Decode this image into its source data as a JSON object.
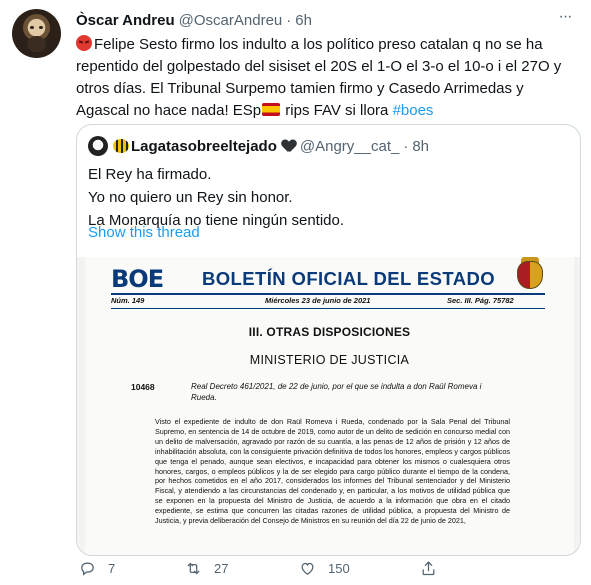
{
  "tweet": {
    "author_name": "Òscar Andreu",
    "author_handle": "@OscarAndreu",
    "separator": "·",
    "time": "6h",
    "more_label": "···",
    "text_part1": "Felipe Sesto firmo los indulto a los político preso catalan q no se ha repentido del golpestado del sisiset el 20S  el 1-O el 3-o  el 10-o i el 27O y otros días. El Tribunal Surpemo tamien firmo y Casedo Arrimedas y Agascal no hace nada! ESp",
    "text_part2": " rips FAV si llora ",
    "hashtag": "#boes",
    "emoji_start": "angry-face",
    "emoji_flag": "spain-flag"
  },
  "quote": {
    "name": "Lagatasobreeltejado",
    "handle": "@Angry__cat_",
    "separator": "·",
    "time": "8h",
    "lines": [
      "El Rey ha firmado.",
      "Yo no quiero un Rey sin honor.",
      "La Monarquía no tiene ningún sentido."
    ],
    "show_thread": "Show this thread"
  },
  "document": {
    "logo": "BOE",
    "title": "BOLETÍN OFICIAL DEL ESTADO",
    "number": "Núm. 149",
    "date": "Miércoles 23 de junio de 2021",
    "section_page": "Sec. III.  Pág. 75782",
    "section_title": "III. OTRAS DISPOSICIONES",
    "ministry": "MINISTERIO DE JUSTICIA",
    "doc_number": "10468",
    "decree": "Real Decreto 461/2021, de 22 de junio, por el que se indulta a don Raül Romeva i Rueda.",
    "body": "Visto el expediente de indulto de don Raül Romeva i Rueda, condenado por la Sala Penal del Tribunal Supremo, en sentencia de 14 de octubre de 2019, como autor de un delito de sedición en concurso medial con un delito de malversación, agravado por razón de su cuantía, a las penas de 12 años de prisión y 12 años de inhabilitación absoluta, con la consiguiente privación definitiva de todos los honores, empleos y cargos públicos que tenga el penado, aunque sean electivos, e incapacidad para obtener los mismos o cualesquiera otros honores, cargos, o empleos públicos y la de ser elegido para cargo público durante el tiempo de la condena, por hechos cometidos en el año 2017, considerados los informes del Tribunal sentenciador y del Ministerio Fiscal, y atendiendo a las circunstancias del condenado y, en particular, a los motivos de utilidad pública que se exponen en la propuesta del Ministro de Justicia, de acuerdo a la información que obra en el citado expediente, se estima que concurren las citadas razones de utilidad pública, a propuesta del Ministro de Justicia, y previa deliberación del Consejo de Ministros en su reunión del día 22 de junio de 2021,"
  },
  "actions": {
    "reply_count": "7",
    "retweet_count": "27",
    "like_count": "150"
  }
}
